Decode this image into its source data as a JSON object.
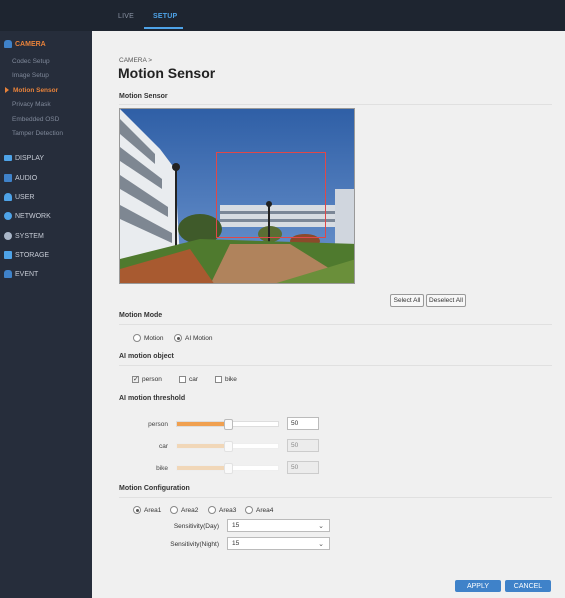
{
  "nav": {
    "live": "LIVE",
    "setup": "SETUP"
  },
  "sidebar": {
    "categories": [
      {
        "label": "CAMERA",
        "icon": "camera-icon",
        "active": true
      },
      {
        "label": "DISPLAY",
        "icon": "display-icon"
      },
      {
        "label": "AUDIO",
        "icon": "audio-icon"
      },
      {
        "label": "USER",
        "icon": "user-icon"
      },
      {
        "label": "NETWORK",
        "icon": "network-icon"
      },
      {
        "label": "SYSTEM",
        "icon": "system-icon"
      },
      {
        "label": "STORAGE",
        "icon": "storage-icon"
      },
      {
        "label": "EVENT",
        "icon": "event-icon"
      }
    ],
    "camera_items": [
      {
        "label": "Codec Setup"
      },
      {
        "label": "Image Setup"
      },
      {
        "label": "Motion Sensor",
        "active": true
      },
      {
        "label": "Privacy Mask"
      },
      {
        "label": "Embedded OSD"
      },
      {
        "label": "Tamper Detection"
      }
    ]
  },
  "page": {
    "breadcrumb": "CAMERA >",
    "title": "Motion Sensor"
  },
  "sections": {
    "motion_sensor": "Motion Sensor",
    "motion_mode": "Motion Mode",
    "ai_object": "AI motion object",
    "ai_threshold": "AI motion threshold",
    "motion_config": "Motion Configuration"
  },
  "buttons": {
    "select_all": "Select All",
    "deselect_all": "Deselect All",
    "apply": "APPLY",
    "cancel": "CANCEL"
  },
  "motion_mode": {
    "options": [
      "Motion",
      "AI Motion"
    ],
    "selected": "AI Motion"
  },
  "ai_objects": [
    {
      "label": "person",
      "checked": true
    },
    {
      "label": "car",
      "checked": false
    },
    {
      "label": "bike",
      "checked": false
    }
  ],
  "thresholds": [
    {
      "label": "person",
      "value": "50",
      "fraction": 0.5,
      "enabled": true
    },
    {
      "label": "car",
      "value": "50",
      "fraction": 0.5,
      "enabled": false
    },
    {
      "label": "bike",
      "value": "50",
      "fraction": 0.5,
      "enabled": false
    }
  ],
  "areas": {
    "options": [
      "Area1",
      "Area2",
      "Area3",
      "Area4"
    ],
    "selected": "Area1"
  },
  "sensitivity": {
    "day_label": "Sensitivity(Day)",
    "day_value": "15",
    "night_label": "Sensitivity(Night)",
    "night_value": "15"
  },
  "colors": {
    "accent": "#e8823a",
    "active_tab": "#4ea3e8",
    "primary_button": "#3f82c9",
    "roi_box": "#e04848"
  }
}
